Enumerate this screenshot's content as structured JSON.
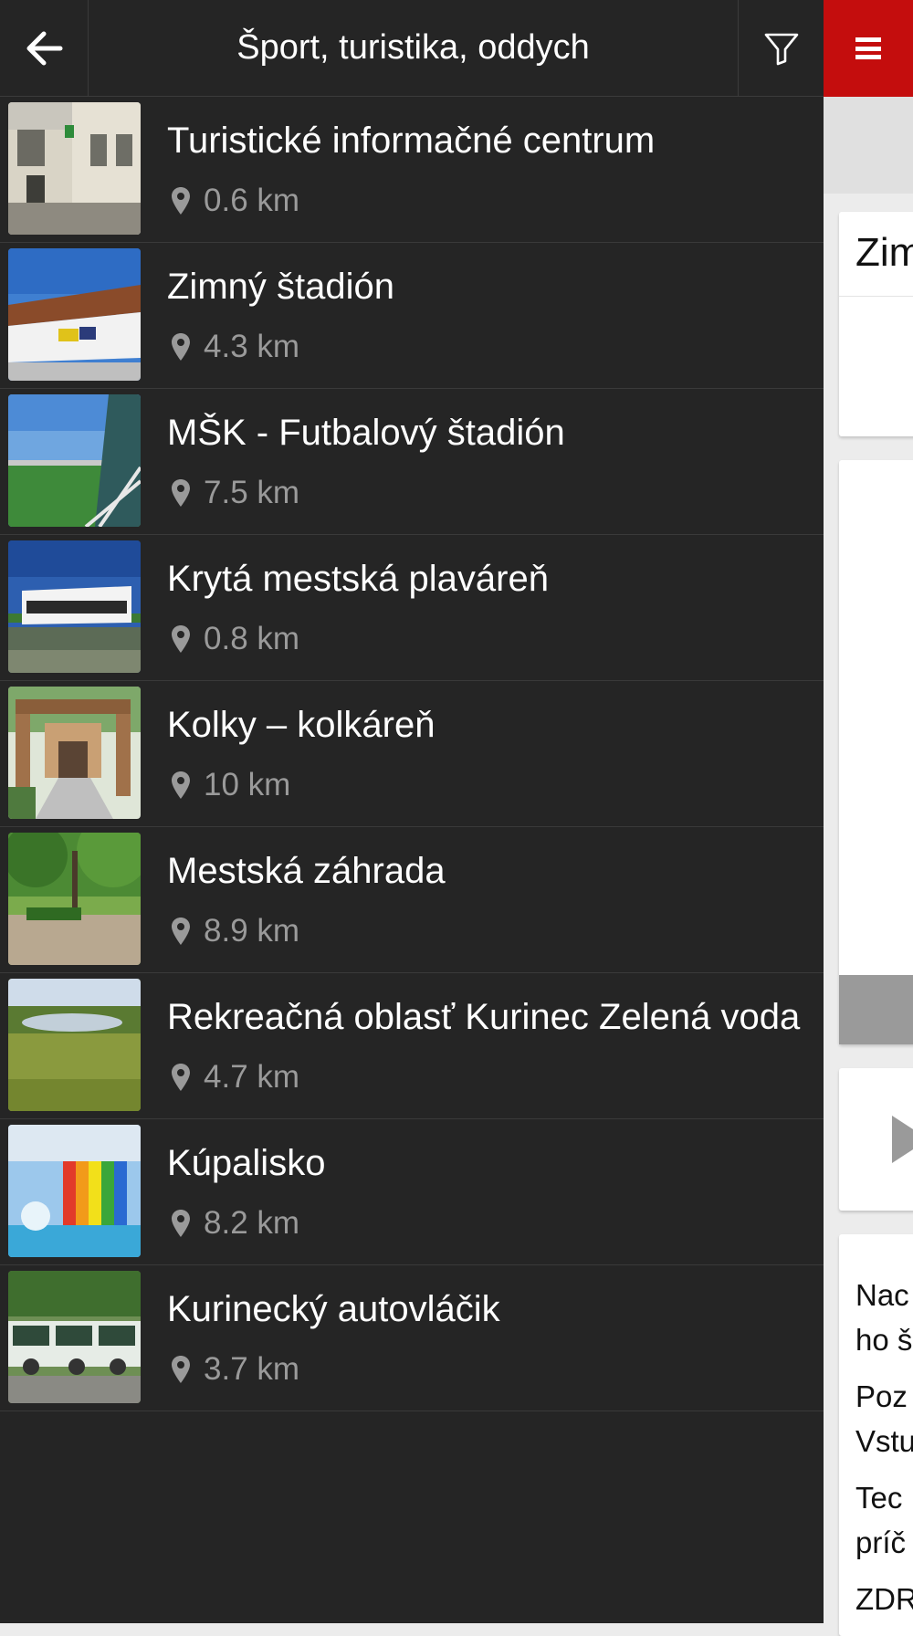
{
  "header": {
    "title": "Šport, turistika, oddych"
  },
  "icons": {
    "back": "arrow-left-icon",
    "filter": "funnel-filter-icon",
    "menu": "hamburger-menu-icon",
    "location": "map-pin-icon",
    "play": "play-icon"
  },
  "colors": {
    "sidebar_bg": "#252525",
    "accent_red": "#c40d0d",
    "distance_text": "#9a9a9a"
  },
  "items": [
    {
      "title": "Turistické informačné centrum",
      "distance": "0.6 km"
    },
    {
      "title": "Zimný štadión",
      "distance": "4.3 km"
    },
    {
      "title": "MŠK - Futbalový štadión",
      "distance": "7.5 km"
    },
    {
      "title": "Krytá mestská plaváreň",
      "distance": "0.8 km"
    },
    {
      "title": "Kolky – kolkáreň",
      "distance": "10 km"
    },
    {
      "title": "Mestská záhrada",
      "distance": "8.9 km"
    },
    {
      "title": "Rekreačná oblasť Kurinec Zelená voda",
      "distance": "4.7 km"
    },
    {
      "title": "Kúpalisko",
      "distance": "8.2 km"
    },
    {
      "title": "Kurinecký autovláčik",
      "distance": "3.7 km"
    }
  ],
  "background_page": {
    "title_fragment": "Zim",
    "text_fragments": [
      "Nac",
      "ho š",
      "Poz",
      "Vstu",
      "Tec",
      "príč",
      "ZDR"
    ]
  }
}
